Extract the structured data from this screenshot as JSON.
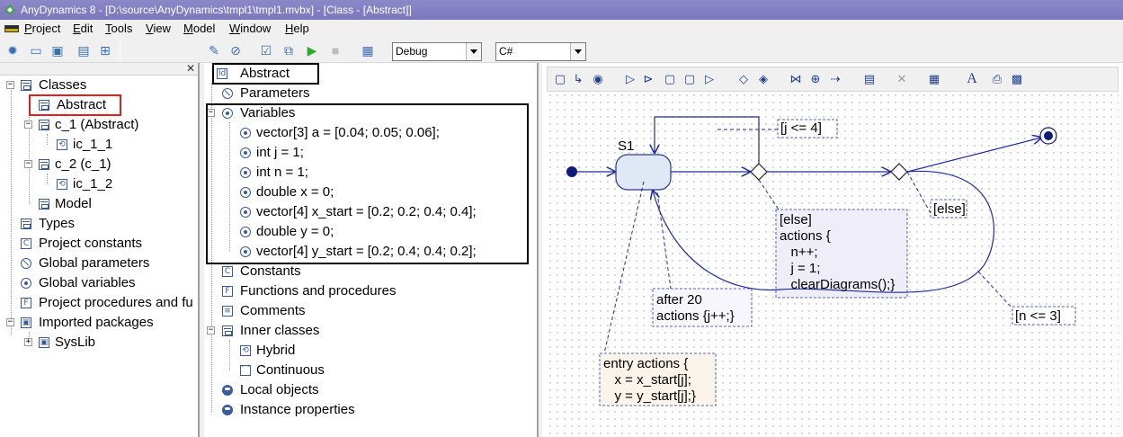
{
  "window": {
    "title": "AnyDynamics 8 - [D:\\source\\AnyDynamics\\tmpl1\\tmpl1.mvbx] - [Class - [Abstract]]"
  },
  "menu": {
    "items": [
      "Project",
      "Edit",
      "Tools",
      "View",
      "Model",
      "Window",
      "Help"
    ]
  },
  "toolbar": {
    "config_value": "Debug",
    "language_value": "C#"
  },
  "left_tree": {
    "classes": "Classes",
    "abstract": "Abstract",
    "c1": "c_1 (Abstract)",
    "ic11": "ic_1_1",
    "c2": "c_2 (c_1)",
    "ic12": "ic_1_2",
    "model": "Model",
    "types": "Types",
    "project_constants": "Project constants",
    "global_parameters": "Global parameters",
    "global_variables": "Global variables",
    "project_procedures": "Project procedures and fu",
    "imported_packages": "Imported packages",
    "syslib": "SysLib"
  },
  "middle_tree": {
    "header": "Abstract",
    "parameters": "Parameters",
    "variables": "Variables",
    "vars": [
      "vector[3] a = [0.04; 0.05; 0.06];",
      "int j = 1;",
      "int n = 1;",
      "double x = 0;",
      "vector[4] x_start = [0.2; 0.2; 0.4; 0.4];",
      "double y = 0;",
      "vector[4] y_start = [0.2; 0.4; 0.4; 0.2];"
    ],
    "constants": "Constants",
    "functions": "Functions and procedures",
    "comments": "Comments",
    "inner_classes": "Inner classes",
    "hybrid": "Hybrid",
    "continuous": "Continuous",
    "local_objects": "Local objects",
    "instance_properties": "Instance properties"
  },
  "diagram": {
    "state_name": "S1",
    "guard_j": "[j <= 4]",
    "guard_else_top": "[else]",
    "else_block": "[else]\nactions {\n   n++;\n   j = 1;\n   clearDiagrams();}",
    "after_block": "after 20\nactions {j++;}",
    "entry_block": "entry actions {\n   x = x_start[j];\n   y = y_start[j];}",
    "guard_n": "[n <= 3]"
  }
}
